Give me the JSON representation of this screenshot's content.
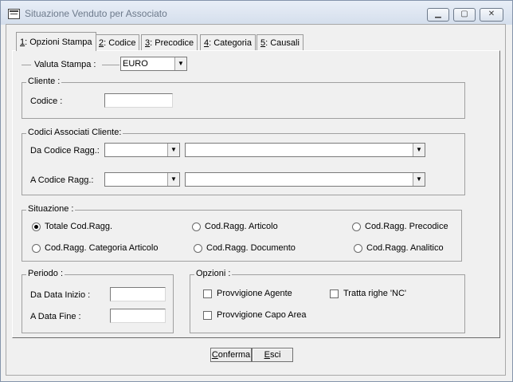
{
  "window": {
    "title": "Situazione Venduto per Associato",
    "controls": {
      "minimize": "▁",
      "maximize": "▢",
      "close": "✕"
    }
  },
  "tabs": [
    {
      "key": "1",
      "label": ": Opzioni Stampa",
      "active": true
    },
    {
      "key": "2",
      "label": ": Codice"
    },
    {
      "key": "3",
      "label": ": Precodice"
    },
    {
      "key": "4",
      "label": ": Categoria"
    },
    {
      "key": "5",
      "label": ": Causali"
    }
  ],
  "valuta": {
    "label": "Valuta Stampa :",
    "value": "EURO"
  },
  "cliente": {
    "group_label": "Cliente :",
    "codice_label": "Codice :",
    "codice_value": ""
  },
  "codici_associati": {
    "group_label": "Codici Associati Cliente:",
    "da_label": "Da Codice Ragg.:",
    "a_label": "A Codice Ragg.:",
    "da_code": "",
    "da_desc": "",
    "a_code": "",
    "a_desc": ""
  },
  "situazione": {
    "group_label": "Situazione :",
    "options": [
      "Totale Cod.Ragg.",
      "Cod.Ragg. Articolo",
      "Cod.Ragg. Precodice",
      "Cod.Ragg. Categoria Articolo",
      "Cod.Ragg. Documento",
      "Cod.Ragg. Analitico"
    ],
    "selected": 0
  },
  "periodo": {
    "group_label": "Periodo :",
    "inizio_label": "Da Data Inizio :",
    "fine_label": "A Data Fine :",
    "inizio_value": "",
    "fine_value": ""
  },
  "opzioni": {
    "group_label": "Opzioni :",
    "provvigione_agente": "Provvigione Agente",
    "tratta_righe": "Tratta righe 'NC'",
    "provvigione_capo_area": "Provvigione Capo Area"
  },
  "buttons": {
    "conferma_hotkey": "C",
    "conferma_rest": "onferma",
    "esci_hotkey": "E",
    "esci_rest": "sci"
  },
  "colors": {
    "title_text": "#6d7a8b",
    "titlebar_top": "#e8eef7",
    "face": "#f0f0f0"
  },
  "icons": {
    "app": "app-window-icon",
    "dropdown": "chevron-down-icon"
  }
}
